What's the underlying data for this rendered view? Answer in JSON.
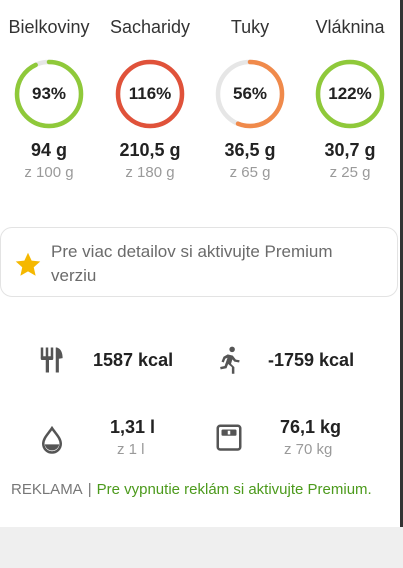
{
  "macros": [
    {
      "name": "Bielkoviny",
      "pct_label": "93%",
      "value": "94 g",
      "goal": "z 100 g",
      "progress": 0.93,
      "color": "#8fc93a"
    },
    {
      "name": "Sacharidy",
      "pct_label": "116%",
      "value": "210,5 g",
      "goal": "z 180 g",
      "progress": 1.16,
      "color": "#e0523a"
    },
    {
      "name": "Tuky",
      "pct_label": "56%",
      "value": "36,5 g",
      "goal": "z 65 g",
      "progress": 0.56,
      "color": "#f08a4b"
    },
    {
      "name": "Vláknina",
      "pct_label": "122%",
      "value": "30,7 g",
      "goal": "z 25 g",
      "progress": 1.22,
      "color": "#8fc93a"
    }
  ],
  "premium": {
    "text": "Pre viac detailov si aktivujte Premium verziu",
    "icon": "star-icon",
    "icon_color": "#f5b800"
  },
  "stats": {
    "food": {
      "icon": "fork-knife-icon",
      "value": "1587 kcal"
    },
    "activity": {
      "icon": "running-person-icon",
      "value": "-1759 kcal"
    },
    "water": {
      "icon": "water-drop-icon",
      "value": "1,31 l",
      "goal": "z 1 l"
    },
    "weight": {
      "icon": "scale-icon",
      "value": "76,1 kg",
      "goal": "z 70 kg"
    }
  },
  "ad": {
    "label": "REKLAMA",
    "separator": "|",
    "link_text": "Pre vypnutie reklám si aktivujte Premium."
  }
}
